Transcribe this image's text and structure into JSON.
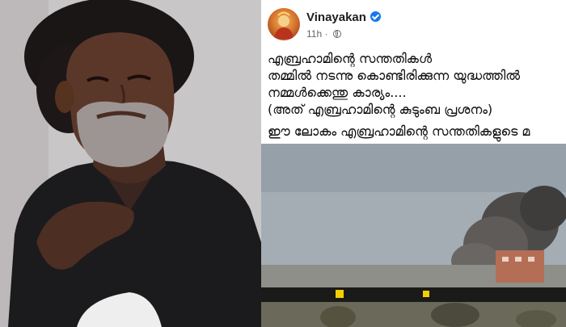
{
  "post": {
    "author": "Vinayakan",
    "time": "11h",
    "visibility_icon": "globe-icon",
    "verified_icon": "verified-badge-icon",
    "lines": [
      "എബ്രഹാമിന്റെ സന്തതികൾ",
      "തമ്മിൽ നടന്നു കൊണ്ടിരിക്കുന്ന യുദ്ധത്തിൽ",
      "നമ്മൾക്കെന്തു  കാര്യം....",
      "(അത് എബ്രഹാമിന്റെ കുടുംബ പ്രശനം)",
      "ഈ ലോകം എബ്രഹാമിന്റെ സന്തതികളുടെ മ"
    ]
  },
  "colors": {
    "verified": "#1877f2",
    "name_text": "#1c1e21",
    "meta_text": "#65676b"
  }
}
